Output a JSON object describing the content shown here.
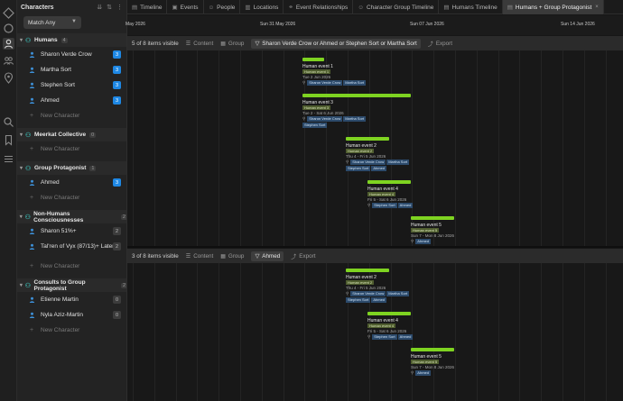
{
  "rail": {
    "icons": [
      "diamond-icon",
      "circle-icon",
      "person-icon",
      "people-icon",
      "location-icon",
      "search-icon",
      "bookmark-icon",
      "list-icon"
    ]
  },
  "sidebar": {
    "title": "Characters",
    "match_label": "Match Any",
    "new_character_label": "New Character",
    "groups": [
      {
        "name": "Humans",
        "count": "4",
        "characters": [
          {
            "name": "Sharon Verde Crow",
            "badge": "3",
            "badge_style": "blue"
          },
          {
            "name": "Martha Sort",
            "badge": "3",
            "badge_style": "blue"
          },
          {
            "name": "Stephen Sort",
            "badge": "3",
            "badge_style": "blue"
          },
          {
            "name": "Ahmed",
            "badge": "3",
            "badge_style": "blue"
          }
        ]
      },
      {
        "name": "Meerkat Collective",
        "count": "0",
        "characters": []
      },
      {
        "name": "Group Protagonist",
        "count": "1",
        "characters": [
          {
            "name": "Ahmed",
            "badge": "3",
            "badge_style": "blue"
          }
        ]
      },
      {
        "name": "Non-Humans Consciousnesses",
        "count": "2",
        "characters": [
          {
            "name": "Sharon 51%+",
            "badge": "2",
            "badge_style": "grey"
          },
          {
            "name": "Tal'ren of Vyx (87/13)+ Later",
            "badge": "2",
            "badge_style": "grey"
          }
        ]
      },
      {
        "name": "Consults to Group Protagonist",
        "count": "2",
        "characters": [
          {
            "name": "Etienne Martin",
            "badge": "0",
            "badge_style": "grey"
          },
          {
            "name": "Nyla Aziz-Martin",
            "badge": "0",
            "badge_style": "grey"
          }
        ]
      }
    ]
  },
  "tabs": [
    {
      "label": "Timeline",
      "icon": "timeline-icon"
    },
    {
      "label": "Events",
      "icon": "events-icon"
    },
    {
      "label": "People",
      "icon": "people-icon"
    },
    {
      "label": "Locations",
      "icon": "locations-icon"
    },
    {
      "label": "Event Relationships",
      "icon": "relationships-icon"
    },
    {
      "label": "Character Group Timeline",
      "icon": "group-timeline-icon"
    },
    {
      "label": "Humans Timeline",
      "icon": "humans-timeline-icon"
    },
    {
      "label": "Humans + Group Protagonist",
      "icon": "combined-timeline-icon",
      "active": true,
      "close": "×"
    }
  ],
  "axis": {
    "labels": [
      "May 2026",
      "Sun 31 May 2026",
      "Sun 07 Jun 2026",
      "Sun 14 Jun 2026"
    ]
  },
  "panel1": {
    "visible_text": "5 of 8 items visible",
    "content_label": "Content",
    "group_label": "Group",
    "filter_label": "Sharon Verde Crow or Ahmed or Stephen Sort or Martha Sort",
    "export_label": "Export",
    "events": [
      {
        "title": "Human event 1",
        "tag": "Human event 1",
        "date": "Tue 2 Jun 2026",
        "chars": [
          "Sharon Verde Crow",
          "Martha Sort"
        ]
      },
      {
        "title": "Human event 3",
        "tag": "Human event 3",
        "date": "Tue 2 - Sat 6 Jun 2026",
        "chars": [
          "Sharon Verde Crow",
          "Martha Sort",
          "Stephen Sort"
        ]
      },
      {
        "title": "Human event 2",
        "tag": "Human event 2",
        "date": "Thu 4 - Fri 5 Jun 2026",
        "chars": [
          "Sharon Verde Crow",
          "Martha Sort",
          "Stephen Sort",
          "Ahmed"
        ]
      },
      {
        "title": "Human event 4",
        "tag": "Human event 4",
        "date": "Fri 5 - Sat 6 Jun 2026",
        "chars": [
          "Stephen Sort",
          "Ahmed"
        ]
      },
      {
        "title": "Human event 5",
        "tag": "Human event 5",
        "date": "Sun 7 - Mon 8 Jun 2026",
        "chars": [
          "Ahmed"
        ]
      }
    ]
  },
  "panel2": {
    "visible_text": "3 of 8 items visible",
    "content_label": "Content",
    "group_label": "Group",
    "filter_label": "Ahmed",
    "export_label": "Export",
    "events": [
      {
        "title": "Human event 2",
        "tag": "Human event 2",
        "date": "Thu 4 - Fri 5 Jun 2026",
        "chars": [
          "Sharon Verde Crow",
          "Martha Sort",
          "Stephen Sort",
          "Ahmed"
        ]
      },
      {
        "title": "Human event 4",
        "tag": "Human event 4",
        "date": "Fri 5 - Sat 6 Jun 2026",
        "chars": [
          "Stephen Sort",
          "Ahmed"
        ]
      },
      {
        "title": "Human event 5",
        "tag": "Human event 5",
        "date": "Sun 7 - Mon 8 Jun 2026",
        "chars": [
          "Ahmed"
        ]
      }
    ]
  },
  "colors": {
    "accent_green": "#7ed321",
    "badge_blue": "#1e88e5",
    "group_icon_teal": "#3aa6a0",
    "character_chip": "#2c4a6b"
  }
}
